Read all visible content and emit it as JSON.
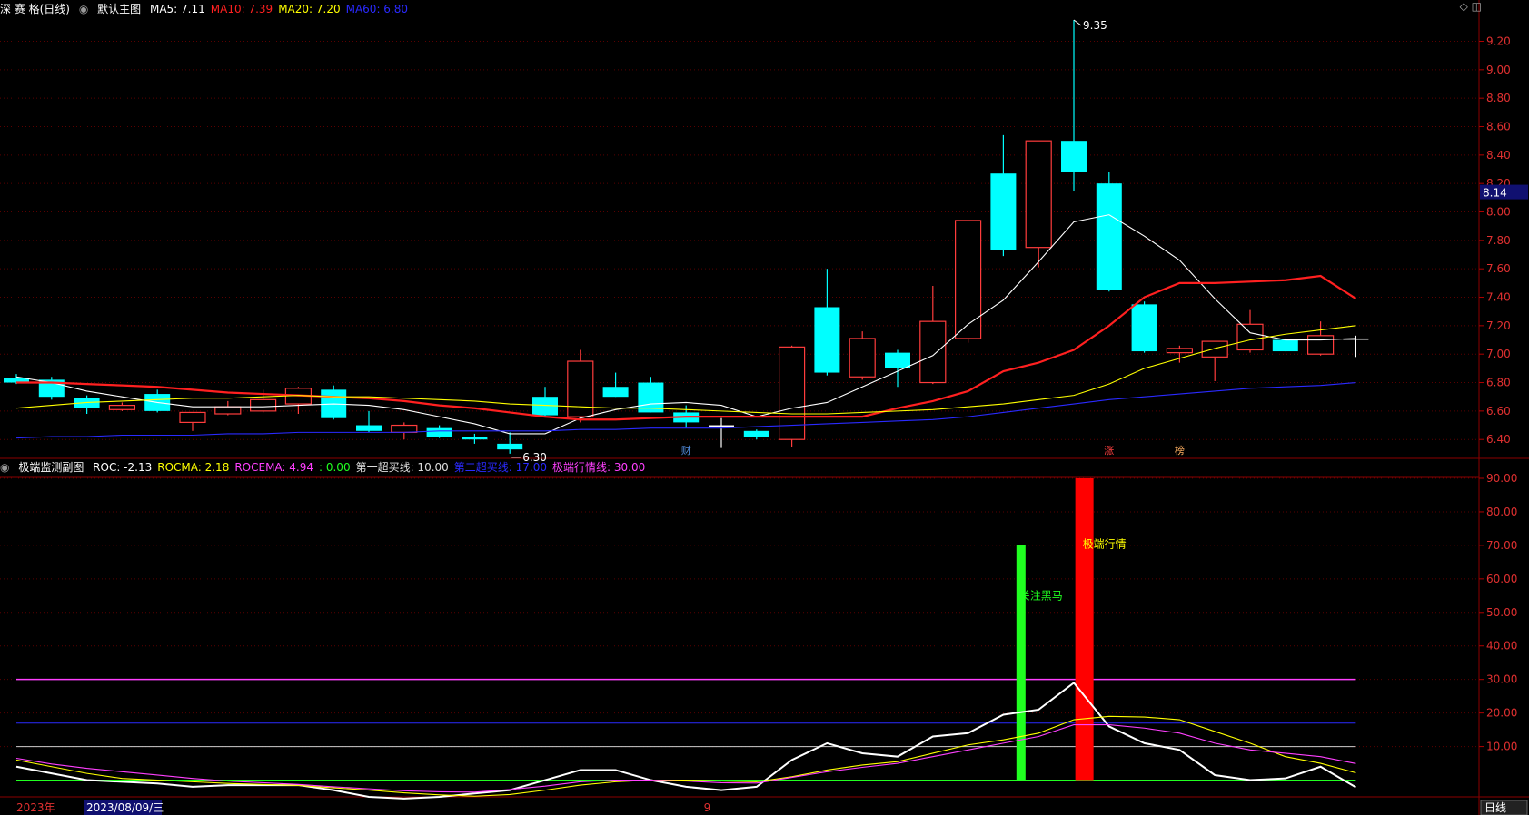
{
  "main": {
    "stock": "深 赛 格(日线)",
    "panel": "默认主图",
    "legend": [
      {
        "text": "MA5: 7.11",
        "color": "#ffffff"
      },
      {
        "text": "MA10: 7.39",
        "color": "#ff2020"
      },
      {
        "text": "MA20: 7.20",
        "color": "#ffff00"
      },
      {
        "text": "MA60: 6.80",
        "color": "#2a2aff"
      }
    ],
    "y_range": [
      6.28,
      9.35
    ],
    "ticks": [
      "9.20",
      "9.00",
      "8.80",
      "8.60",
      "8.40",
      "8.20",
      "8.00",
      "7.80",
      "7.60",
      "7.40",
      "7.20",
      "7.00",
      "6.80",
      "6.60",
      "6.40"
    ],
    "current_price": "8.14",
    "high_label": "9.35",
    "low_label": "6.30",
    "markers": [
      {
        "text": "财",
        "color": "#4e88d6",
        "index": 19
      },
      {
        "text": "涨",
        "color": "#ff4040",
        "index": 31
      },
      {
        "text": "榜",
        "color": "#ffb060",
        "index": 33
      }
    ]
  },
  "chart_data": [
    {
      "type": "candlestick",
      "title": "默认主图",
      "candles": [
        {
          "o": 6.83,
          "h": 6.86,
          "l": 6.79,
          "c": 6.8
        },
        {
          "o": 6.82,
          "h": 6.84,
          "l": 6.68,
          "c": 6.7
        },
        {
          "o": 6.69,
          "h": 6.71,
          "l": 6.58,
          "c": 6.62
        },
        {
          "o": 6.61,
          "h": 6.66,
          "l": 6.6,
          "c": 6.64
        },
        {
          "o": 6.72,
          "h": 6.75,
          "l": 6.59,
          "c": 6.6
        },
        {
          "o": 6.52,
          "h": 6.59,
          "l": 6.46,
          "c": 6.59
        },
        {
          "o": 6.58,
          "h": 6.67,
          "l": 6.57,
          "c": 6.63
        },
        {
          "o": 6.6,
          "h": 6.75,
          "l": 6.59,
          "c": 6.68
        },
        {
          "o": 6.65,
          "h": 6.77,
          "l": 6.58,
          "c": 6.76
        },
        {
          "o": 6.75,
          "h": 6.78,
          "l": 6.54,
          "c": 6.55
        },
        {
          "o": 6.5,
          "h": 6.6,
          "l": 6.45,
          "c": 6.46
        },
        {
          "o": 6.45,
          "h": 6.52,
          "l": 6.4,
          "c": 6.5
        },
        {
          "o": 6.48,
          "h": 6.5,
          "l": 6.41,
          "c": 6.42
        },
        {
          "o": 6.42,
          "h": 6.44,
          "l": 6.37,
          "c": 6.4
        },
        {
          "o": 6.37,
          "h": 6.45,
          "l": 6.3,
          "c": 6.33
        },
        {
          "o": 6.7,
          "h": 6.77,
          "l": 6.56,
          "c": 6.57
        },
        {
          "o": 6.56,
          "h": 7.03,
          "l": 6.52,
          "c": 6.95
        },
        {
          "o": 6.77,
          "h": 6.87,
          "l": 6.7,
          "c": 6.7
        },
        {
          "o": 6.8,
          "h": 6.84,
          "l": 6.59,
          "c": 6.59
        },
        {
          "o": 6.59,
          "h": 6.64,
          "l": 6.48,
          "c": 6.52
        },
        {
          "o": 6.5,
          "h": 6.55,
          "l": 6.34,
          "c": 6.5
        },
        {
          "o": 6.46,
          "h": 6.47,
          "l": 6.4,
          "c": 6.42
        },
        {
          "o": 6.4,
          "h": 7.06,
          "l": 6.35,
          "c": 7.05
        },
        {
          "o": 7.33,
          "h": 7.6,
          "l": 6.85,
          "c": 6.87
        },
        {
          "o": 6.84,
          "h": 7.16,
          "l": 6.82,
          "c": 7.11
        },
        {
          "o": 7.01,
          "h": 7.03,
          "l": 6.77,
          "c": 6.9
        },
        {
          "o": 6.8,
          "h": 7.48,
          "l": 6.79,
          "c": 7.23
        },
        {
          "o": 7.11,
          "h": 7.94,
          "l": 7.08,
          "c": 7.94
        },
        {
          "o": 8.27,
          "h": 8.54,
          "l": 7.69,
          "c": 7.73
        },
        {
          "o": 7.75,
          "h": 8.5,
          "l": 7.61,
          "c": 8.5
        },
        {
          "o": 8.5,
          "h": 9.35,
          "l": 8.15,
          "c": 8.28
        },
        {
          "o": 8.2,
          "h": 8.28,
          "l": 7.44,
          "c": 7.45
        },
        {
          "o": 7.35,
          "h": 7.37,
          "l": 7.01,
          "c": 7.02
        },
        {
          "o": 7.01,
          "h": 7.06,
          "l": 6.94,
          "c": 7.04
        },
        {
          "o": 6.98,
          "h": 7.09,
          "l": 6.81,
          "c": 7.09
        },
        {
          "o": 7.03,
          "h": 7.31,
          "l": 7.01,
          "c": 7.21
        },
        {
          "o": 7.1,
          "h": 7.11,
          "l": 7.02,
          "c": 7.02
        },
        {
          "o": 7.0,
          "h": 7.23,
          "l": 6.99,
          "c": 7.13
        },
        {
          "o": 7.11,
          "h": 7.13,
          "l": 6.98,
          "c": 7.11
        }
      ],
      "series": [
        {
          "name": "MA5",
          "color": "#ffffff",
          "values": [
            6.84,
            6.8,
            6.74,
            6.7,
            6.66,
            6.63,
            6.63,
            6.63,
            6.64,
            6.65,
            6.64,
            6.61,
            6.56,
            6.51,
            6.44,
            6.44,
            6.55,
            6.61,
            6.65,
            6.66,
            6.64,
            6.56,
            6.62,
            6.66,
            6.77,
            6.88,
            6.99,
            7.21,
            7.38,
            7.65,
            7.93,
            7.98,
            7.83,
            7.66,
            7.39,
            7.15,
            7.1,
            7.1,
            7.11
          ]
        },
        {
          "name": "MA10",
          "color": "#ff2020",
          "values": [
            6.8,
            6.8,
            6.79,
            6.78,
            6.77,
            6.75,
            6.73,
            6.72,
            6.71,
            6.7,
            6.69,
            6.67,
            6.64,
            6.62,
            6.59,
            6.56,
            6.54,
            6.54,
            6.55,
            6.56,
            6.56,
            6.56,
            6.56,
            6.56,
            6.56,
            6.62,
            6.67,
            6.74,
            6.88,
            6.94,
            7.03,
            7.2,
            7.4,
            7.5,
            7.5,
            7.51,
            7.52,
            7.55,
            7.39
          ]
        },
        {
          "name": "MA20",
          "color": "#ffff00",
          "values": [
            6.62,
            6.64,
            6.66,
            6.67,
            6.68,
            6.69,
            6.69,
            6.7,
            6.71,
            6.7,
            6.7,
            6.69,
            6.68,
            6.67,
            6.65,
            6.64,
            6.63,
            6.62,
            6.62,
            6.61,
            6.6,
            6.59,
            6.58,
            6.58,
            6.59,
            6.6,
            6.61,
            6.63,
            6.65,
            6.68,
            6.71,
            6.79,
            6.9,
            6.97,
            7.04,
            7.1,
            7.14,
            7.17,
            7.2
          ]
        },
        {
          "name": "MA60",
          "color": "#2a2aff",
          "values": [
            6.41,
            6.42,
            6.42,
            6.43,
            6.43,
            6.43,
            6.44,
            6.44,
            6.45,
            6.45,
            6.45,
            6.45,
            6.46,
            6.46,
            6.46,
            6.46,
            6.47,
            6.47,
            6.48,
            6.48,
            6.48,
            6.49,
            6.5,
            6.51,
            6.52,
            6.53,
            6.54,
            6.56,
            6.59,
            6.62,
            6.65,
            6.68,
            6.7,
            6.72,
            6.74,
            6.76,
            6.77,
            6.78,
            6.8
          ]
        }
      ]
    },
    {
      "type": "line",
      "title": "极端监测副图",
      "ylim": [
        -5,
        90
      ],
      "ticks": [
        "90.00",
        "80.00",
        "70.00",
        "60.00",
        "50.00",
        "40.00",
        "30.00",
        "20.00",
        "10.00"
      ],
      "legend": [
        {
          "text": "ROC: -2.13",
          "color": "#ffffff"
        },
        {
          "text": "ROCMA: 2.18",
          "color": "#ffff00"
        },
        {
          "text": "ROCEMA: 4.94",
          "color": "#ff40ff"
        },
        {
          "text": ": 0.00",
          "color": "#20ff20"
        },
        {
          "text": "第一超买线: 10.00",
          "color": "#dddddd"
        },
        {
          "text": "第二超买线: 17.00",
          "color": "#2a2aff"
        },
        {
          "text": "极端行情线: 30.00",
          "color": "#ff40ff"
        }
      ],
      "hlines": [
        {
          "name": "极端行情线",
          "value": 30,
          "color": "#ff40ff"
        },
        {
          "name": "第二超买线",
          "value": 17,
          "color": "#2a2aff"
        },
        {
          "name": "第一超买线",
          "value": 10,
          "color": "#cccccc"
        },
        {
          "name": "零线",
          "value": 0,
          "color": "#20ff20"
        }
      ],
      "series": [
        {
          "name": "ROC",
          "color": "#ffffff",
          "values": [
            4,
            2,
            0,
            -0.5,
            -1,
            -2,
            -1.5,
            -1.5,
            -1.5,
            -3,
            -5,
            -5.5,
            -5,
            -4,
            -3,
            0,
            3,
            3,
            0,
            -2,
            -3,
            -2,
            6,
            11,
            8,
            7,
            13,
            14,
            19.5,
            21,
            29,
            16,
            11,
            9,
            1.5,
            0,
            0.5,
            4,
            -2.13
          ]
        },
        {
          "name": "ROCMA",
          "color": "#ffff00",
          "values": [
            6,
            4,
            2,
            0.5,
            0,
            -0.5,
            -1,
            -1.3,
            -1.6,
            -2.3,
            -3,
            -3.8,
            -4.4,
            -4.8,
            -4.3,
            -3,
            -1.5,
            -0.5,
            0,
            0,
            -0.3,
            -0.5,
            1,
            3,
            4.5,
            5.5,
            8,
            10.5,
            12,
            14,
            18,
            19,
            18.8,
            18,
            14.5,
            11,
            7,
            5,
            2.18
          ]
        },
        {
          "name": "ROCEMA",
          "color": "#ff40ff",
          "values": [
            6.5,
            4.8,
            3.5,
            2.5,
            1.5,
            0.5,
            -0.3,
            -0.8,
            -1.3,
            -2,
            -2.6,
            -3.2,
            -3.5,
            -3.6,
            -2.8,
            -1.8,
            -0.5,
            0,
            0,
            -0.3,
            -0.8,
            -0.9,
            0.8,
            2.5,
            3.8,
            5,
            7,
            9,
            11,
            13,
            16.5,
            16.5,
            15.5,
            14,
            11,
            9,
            8,
            7,
            4.94
          ]
        }
      ],
      "bars": [
        {
          "index": 28.5,
          "from": 0,
          "to": 70,
          "color": "#20ff20",
          "label": "关注黑马"
        },
        {
          "index": 30.3,
          "from": 0,
          "to": 90,
          "color": "#ff0000",
          "label": "极端行情"
        }
      ]
    }
  ],
  "xaxis": {
    "year": "2023年",
    "cursor_date": "2023/08/09/三",
    "month": "9",
    "period": "日线"
  }
}
